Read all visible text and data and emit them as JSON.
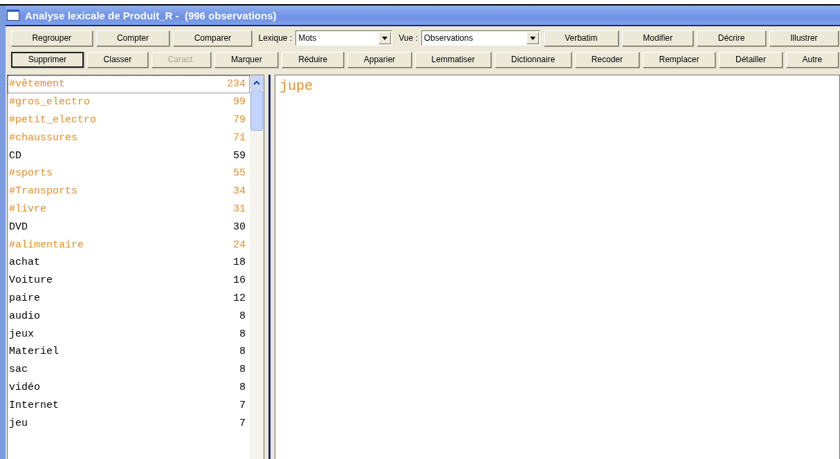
{
  "window": {
    "title": "Analyse lexicale de Produit_R -  (996 observations)"
  },
  "toolbar_row_1": [
    {
      "kind": "button",
      "label": "Regrouper",
      "disabled": false,
      "focused": false
    },
    {
      "kind": "button",
      "label": "Compter",
      "disabled": false,
      "focused": false
    },
    {
      "kind": "button",
      "label": "Comparer",
      "disabled": false,
      "focused": false
    },
    {
      "kind": "dropdown",
      "label": "Lexique :",
      "value": "Mots"
    },
    {
      "kind": "dropdown",
      "label": "Vue :",
      "value": "Observations"
    },
    {
      "kind": "button",
      "label": "Verbatim",
      "disabled": false,
      "focused": false
    },
    {
      "kind": "button",
      "label": "Modifier",
      "disabled": false,
      "focused": false
    },
    {
      "kind": "button",
      "label": "Décrire",
      "disabled": false,
      "focused": false
    },
    {
      "kind": "button",
      "label": "Illustrer",
      "disabled": false,
      "focused": false
    }
  ],
  "toolbar_row_2": [
    {
      "kind": "button",
      "label": "Supprimer",
      "disabled": false,
      "focused": true
    },
    {
      "kind": "button",
      "label": "Classer",
      "disabled": false,
      "focused": false
    },
    {
      "kind": "button",
      "label": "Caract.",
      "disabled": true,
      "focused": false
    },
    {
      "kind": "button",
      "label": "Marquer",
      "disabled": false,
      "focused": false
    },
    {
      "kind": "button",
      "label": "Réduire",
      "disabled": false,
      "focused": false
    },
    {
      "kind": "button",
      "label": "Apparier",
      "disabled": false,
      "focused": false
    },
    {
      "kind": "button",
      "label": "Lemmatiser",
      "disabled": false,
      "focused": false
    },
    {
      "kind": "button",
      "label": "Dictionnaire",
      "disabled": false,
      "focused": false
    },
    {
      "kind": "button",
      "label": "Recoder",
      "disabled": false,
      "focused": false
    },
    {
      "kind": "button",
      "label": "Remplacer",
      "disabled": false,
      "focused": false
    },
    {
      "kind": "button",
      "label": "Détailler",
      "disabled": false,
      "focused": false
    },
    {
      "kind": "button",
      "label": "Autre",
      "disabled": false,
      "focused": false
    }
  ],
  "lexicon": [
    {
      "kind": "category",
      "word": "#vêtement",
      "count": "234",
      "selected": true
    },
    {
      "kind": "category",
      "word": "#gros_electro",
      "count": "99",
      "selected": false
    },
    {
      "kind": "category",
      "word": "#petit_electro",
      "count": "79",
      "selected": false
    },
    {
      "kind": "category",
      "word": "#chaussures",
      "count": "71",
      "selected": false
    },
    {
      "kind": "word",
      "word": "CD",
      "count": "59",
      "selected": false
    },
    {
      "kind": "category",
      "word": "#sports",
      "count": "55",
      "selected": false
    },
    {
      "kind": "category",
      "word": "#Transports",
      "count": "34",
      "selected": false
    },
    {
      "kind": "category",
      "word": "#livre",
      "count": "31",
      "selected": false
    },
    {
      "kind": "word",
      "word": "DVD",
      "count": "30",
      "selected": false
    },
    {
      "kind": "category",
      "word": "#alimentaire",
      "count": "24",
      "selected": false
    },
    {
      "kind": "word",
      "word": "achat",
      "count": "18",
      "selected": false
    },
    {
      "kind": "word",
      "word": "Voiture",
      "count": "16",
      "selected": false
    },
    {
      "kind": "word",
      "word": "paire",
      "count": "12",
      "selected": false
    },
    {
      "kind": "word",
      "word": "audio",
      "count": "8",
      "selected": false
    },
    {
      "kind": "word",
      "word": "jeux",
      "count": "8",
      "selected": false
    },
    {
      "kind": "word",
      "word": "Materiel",
      "count": "8",
      "selected": false
    },
    {
      "kind": "word",
      "word": "sac",
      "count": "8",
      "selected": false
    },
    {
      "kind": "word",
      "word": "vidéo",
      "count": "8",
      "selected": false
    },
    {
      "kind": "word",
      "word": "Internet",
      "count": "7",
      "selected": false
    },
    {
      "kind": "word",
      "word": "jeu",
      "count": "7",
      "selected": false
    }
  ],
  "verbatim": {
    "text": "jupe"
  }
}
